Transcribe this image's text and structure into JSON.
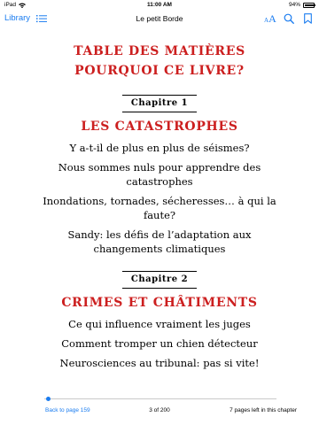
{
  "status_bar": {
    "device": "iPad",
    "time": "11:00 AM",
    "battery_percent": "94%",
    "battery_level": 0.94
  },
  "toolbar": {
    "library_label": "Library",
    "book_title": "Le petit Borde",
    "font_small": "A",
    "font_big": "A"
  },
  "toc": {
    "front_matter": [
      "TABLE DES MATIÈRES",
      "POURQUOI CE LIVRE?"
    ],
    "chapters": [
      {
        "label": "Chapitre 1",
        "title": "LES CATASTROPHES",
        "entries": [
          "Y a-t-il de plus en plus de séismes?",
          "Nous sommes nuls pour apprendre des catastrophes",
          "Inondations, tornades, sécheresses… à qui la faute?",
          "Sandy: les défis de l’adaptation aux changements climatiques"
        ]
      },
      {
        "label": "Chapitre 2",
        "title": "CRIMES ET CHÂTIMENTS",
        "entries": [
          "Ce qui influence vraiment les juges",
          "Comment tromper un chien détecteur",
          "Neurosciences au tribunal: pas si vite!"
        ]
      }
    ]
  },
  "footer": {
    "back_link": "Back to page 159",
    "page_count": "3 of 200",
    "pages_left": "7 pages left in this chapter",
    "progress": 0.015
  },
  "colors": {
    "accent": "#1a7cf0",
    "heading_red": "#cc1f1f"
  }
}
